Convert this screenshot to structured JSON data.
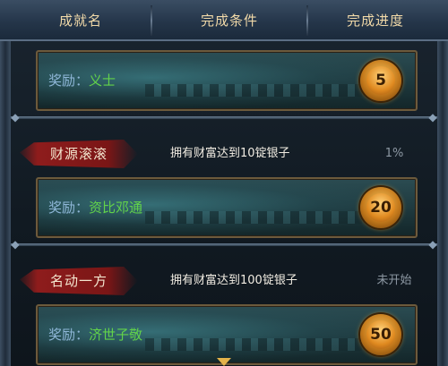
{
  "header": {
    "col_name": "成就名",
    "col_condition": "完成条件",
    "col_progress": "完成进度"
  },
  "reward_prefix": "奖励：",
  "achievements": [
    {
      "name": "",
      "condition": "",
      "progress": "",
      "reward": "义士",
      "points": "5"
    },
    {
      "name": "财源滚滚",
      "condition": "拥有财富达到10锭银子",
      "progress": "1%",
      "reward": "资比邓通",
      "points": "20"
    },
    {
      "name": "名动一方",
      "condition": "拥有财富达到100锭银子",
      "progress": "未开始",
      "reward": "济世子敬",
      "points": "50"
    }
  ],
  "icons": {
    "badge": "medal-icon",
    "scroll": "chevron-down-icon"
  },
  "colors": {
    "reward_value": "#62d24a",
    "header_text": "#f1d9a8",
    "badge": "#e08a20",
    "ribbon": "#8e1c1c"
  }
}
